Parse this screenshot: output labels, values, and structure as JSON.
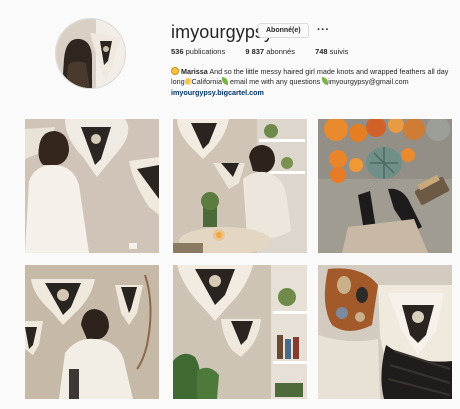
{
  "profile": {
    "username": "imyourgypsy",
    "follow_label": "Abonné(e)",
    "more_label": "···",
    "stats": {
      "posts": "536",
      "posts_label": "publications",
      "followers": "9 837",
      "followers_label": "abonnés",
      "following": "748",
      "following_label": "suivis"
    },
    "bio": {
      "name": "Marissa",
      "line1_text": " And so the little messy haired girl made knots and wrapped feathers all day long",
      "place": "California",
      "line2_text": " email me with any questions ",
      "email": "imyourgypsy@gmail.com",
      "link": "imyourgypsy.bigcartel.com"
    }
  },
  "icons": [
    "smile-emoji-icon",
    "moon-emoji-icon",
    "leaf-emoji-icon",
    "more-options-icon"
  ],
  "colors": {
    "background": "#fafafa",
    "text": "#262626",
    "link": "#003569",
    "border": "#dbdbdb"
  }
}
